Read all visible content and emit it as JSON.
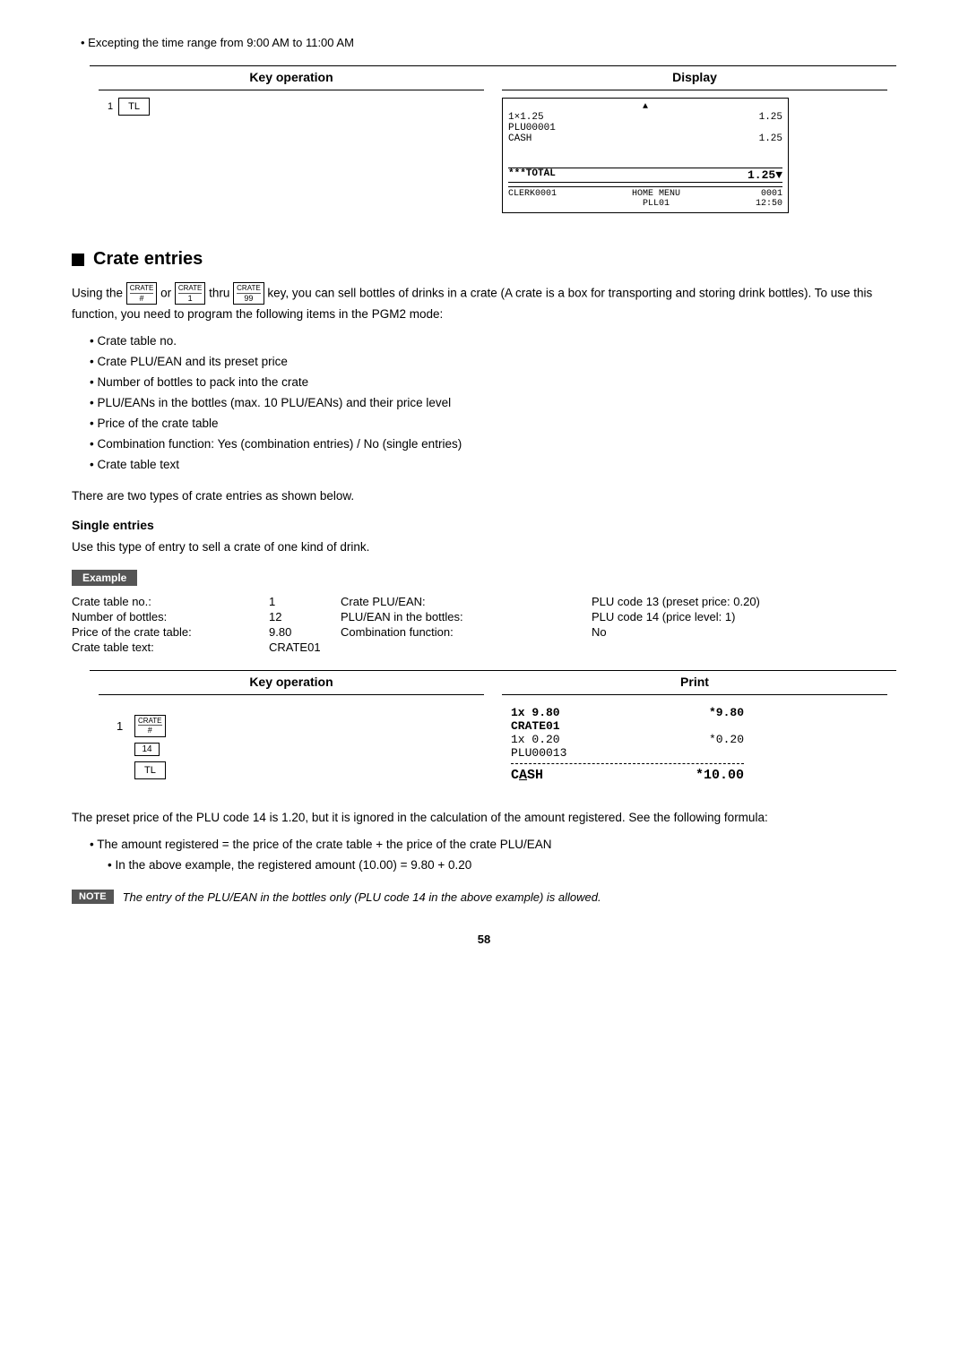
{
  "intro": {
    "note": "• Excepting the time range from 9:00 AM to 11:00 AM"
  },
  "top_example": {
    "key_operation_header": "Key operation",
    "display_header": "Display",
    "key_tl": "TL",
    "key_1": "1",
    "display": {
      "arrow": "▲",
      "rows": [
        {
          "left": "1×1.25",
          "right": "1.25"
        },
        {
          "left": "PLU00001",
          "right": ""
        },
        {
          "left": "CASH",
          "right": "1.25"
        }
      ],
      "total_label": "***TOTAL",
      "total_value": "1.25▼",
      "footer_left": "CLERK0001",
      "footer_mid": "HOME MENU",
      "footer_right": "0001",
      "footer_pll": "PLL01",
      "footer_time": "12:50"
    }
  },
  "section": {
    "square": "■",
    "title": "Crate entries"
  },
  "intro_text": "Using the  or  thru  key, you can sell bottles of drinks in a crate (A crate is a box for transporting and storing drink bottles). To use this function, you need to program the following items in the PGM2 mode:",
  "bullets": [
    "Crate table no.",
    "Crate PLU/EAN and its preset price",
    "Number of bottles to pack into the crate",
    "PLU/EANs in the bottles (max. 10 PLU/EANs) and their price level",
    "Price of the crate table",
    "Combination function: Yes (combination entries) / No (single entries)",
    "Crate table text"
  ],
  "two_types_text": "There are two types of crate entries as shown below.",
  "single_entries": {
    "heading": "Single entries",
    "description": "Use this type of entry to sell a crate of one kind of drink."
  },
  "example_label": "Example",
  "params": [
    {
      "label": "Crate table no.:",
      "value": "1",
      "label2": "Crate PLU/EAN:",
      "value2": "PLU code 13 (preset price: 0.20)"
    },
    {
      "label": "Number of bottles:",
      "value": "12",
      "label2": "PLU/EAN in the bottles:",
      "value2": "PLU code 14 (price level: 1)"
    },
    {
      "label": "Price of the crate table:",
      "value": "9.80",
      "label2": "Combination function:",
      "value2": "No"
    },
    {
      "label": "Crate table text:",
      "value": "CRATE01",
      "label2": "",
      "value2": ""
    }
  ],
  "key_print": {
    "key_operation_header": "Key operation",
    "print_header": "Print",
    "key_steps": [
      {
        "number": "1",
        "key": "CRATE\n#"
      },
      {
        "number": "",
        "key": "14"
      },
      {
        "number": "",
        "key": "TL"
      }
    ],
    "receipt_lines": [
      {
        "left": "1x 9.80",
        "right": "*9.80",
        "bold": true
      },
      {
        "left": "CRATE01",
        "right": "",
        "bold": true
      },
      {
        "left": "1x 0.20",
        "right": "*0.20",
        "bold": false
      },
      {
        "left": "PLU00013",
        "right": "",
        "bold": false
      },
      {
        "divider": true
      },
      {
        "left": "CASH",
        "right": "*10.00",
        "bold": true,
        "large": true
      }
    ]
  },
  "formula_intro": "The preset price of the PLU code 14 is 1.20, but it is ignored in the calculation of the amount registered. See the following formula:",
  "formula_bullets": [
    "The amount registered = the price of the crate table + the price of the crate PLU/EAN",
    "In the above example, the registered amount (10.00) = 9.80 + 0.20"
  ],
  "note": {
    "label": "NOTE",
    "text": "The entry of the PLU/EAN in the bottles only (PLU code 14 in the above example) is allowed."
  },
  "page_number": "58"
}
